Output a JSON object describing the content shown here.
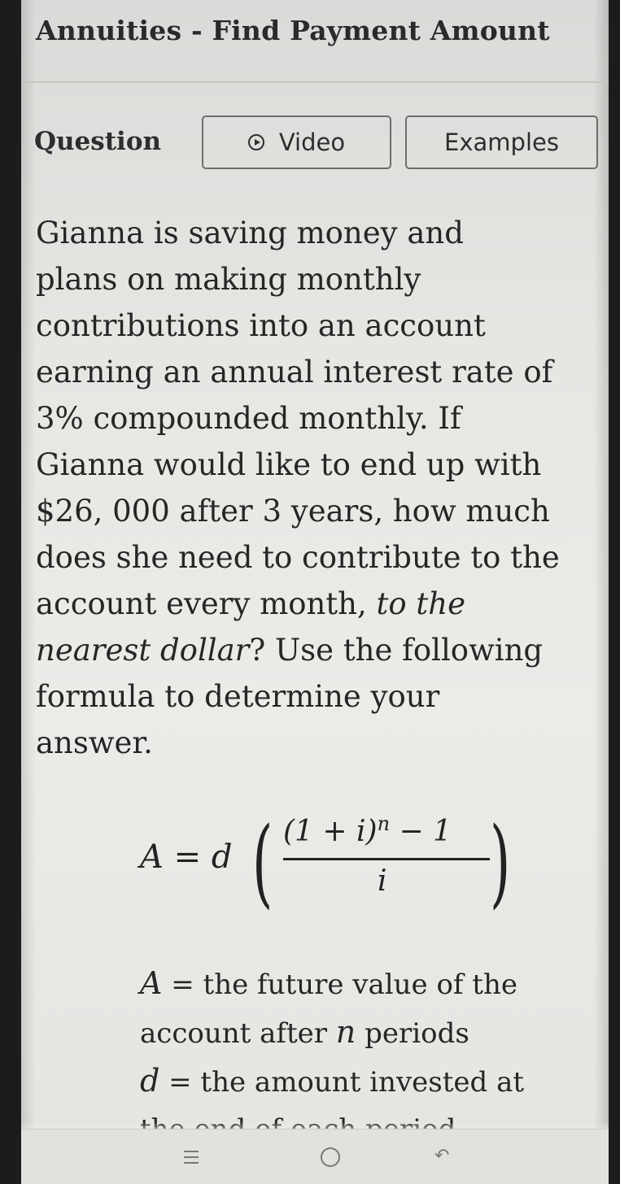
{
  "header": {
    "title": "Annuities - Find Payment Amount"
  },
  "tabs": {
    "question_label": "Question",
    "video_label": "Video",
    "examples_label": "Examples"
  },
  "question": {
    "lines": [
      "Gianna is saving money and",
      "plans on making monthly",
      "contributions into an account",
      "earning an annual interest rate of",
      "3% compounded monthly. If",
      "Gianna would like to end up with",
      "$26, 000 after 3 years, how much",
      "does she need to contribute to the",
      "account every month,",
      "to the",
      "nearest dollar",
      "? Use the following",
      "formula to determine your",
      "answer."
    ]
  },
  "formula": {
    "lhs": "A = d",
    "numerator_base": "(1 + i)",
    "numerator_exp": "n",
    "numerator_tail": " − 1",
    "denominator": "i"
  },
  "definitions": {
    "a_symbol": "A",
    "a_text_1": " = the future value of the",
    "a_text_2": "account after ",
    "a_text_n": "n",
    "a_text_3": " periods",
    "d_symbol": "d",
    "d_text_1": " = the amount invested at",
    "d_text_2": "the end of each period"
  },
  "icons": {
    "video": "play-circle-icon",
    "nav_recents": "recents-icon",
    "nav_home": "home-icon",
    "nav_back": "back-icon"
  },
  "colors": {
    "background": "#ecebe8",
    "text": "#262626",
    "tab_border": "#6e6d6b"
  }
}
